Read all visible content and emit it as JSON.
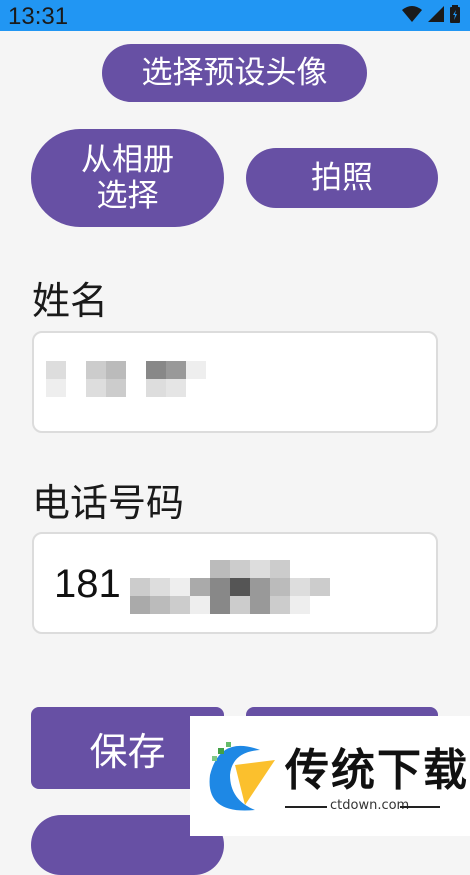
{
  "status_bar": {
    "time": "13:31"
  },
  "buttons": {
    "preset_avatar": "选择预设头像",
    "from_album": "从相册\n选择",
    "take_photo": "拍照",
    "save": "保存"
  },
  "fields": {
    "name_label": "姓名",
    "phone_label": "电话号码",
    "phone_value_visible": "181"
  },
  "watermark": {
    "text": "传统下载",
    "url": "ctdown.com"
  }
}
